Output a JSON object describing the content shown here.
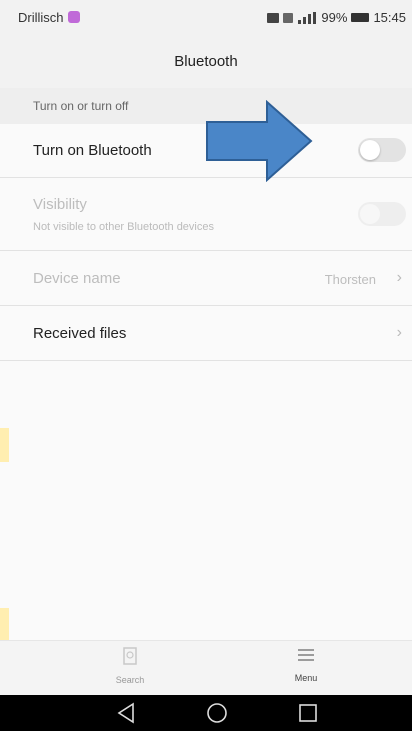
{
  "status_bar": {
    "carrier": "Drillisch",
    "battery": "99%",
    "time": "15:45"
  },
  "header": {
    "title": "Bluetooth"
  },
  "section": {
    "label": "Turn on or turn off"
  },
  "settings": {
    "bluetooth_label": "Turn on Bluetooth",
    "bluetooth_on": false,
    "visibility_label": "Visibility",
    "visibility_sub": "Not visible to other Bluetooth devices",
    "visibility_on": false,
    "device_name_label": "Device name",
    "device_name_value": "Thorsten",
    "received_files_label": "Received files"
  },
  "bottom_bar": {
    "search_label": "Search",
    "menu_label": "Menu"
  },
  "colors": {
    "arrow_fill": "#4a86c8",
    "arrow_stroke": "#2e5f96",
    "side_mark": "#ffeeb0"
  }
}
